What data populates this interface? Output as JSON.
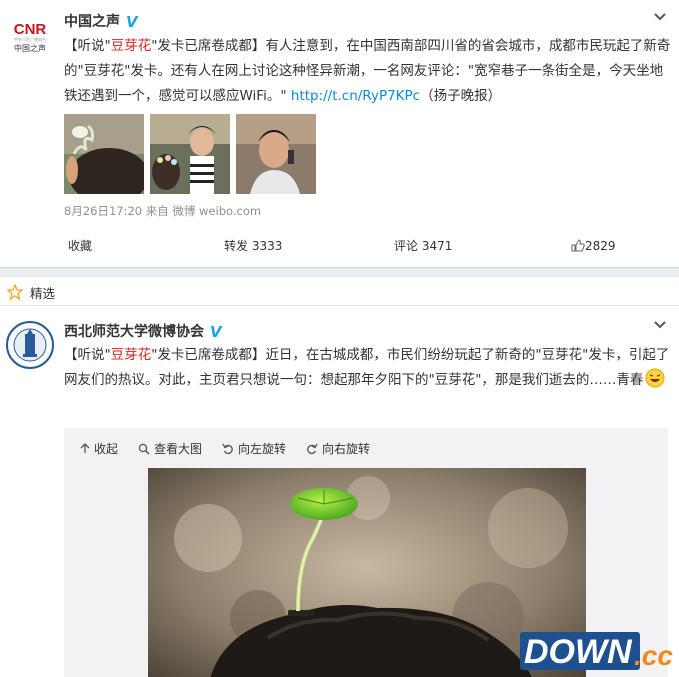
{
  "post1": {
    "avatar_text": "CNR",
    "avatar_sub": "中国之声",
    "username": "中国之声",
    "verified_badge": "V",
    "text_parts": {
      "bracket_open": "【听说\"",
      "highlight": "豆芽花",
      "bracket_rest": "\"发卡已席卷成都】",
      "body": "有人注意到，在中国西南部四川省的省会城市，成都市民玩起了新奇的\"豆芽花\"发卡。还有人在网上讨论这种怪异新潮，一名网友评论：\"宽窄巷子一条街全是，今天坐地铁还遇到一个，感觉可以感应WiFi。\"",
      "link": "http://t.cn/RyP7KPc",
      "source_tag": "（扬子晚报）"
    },
    "timestamp": "8月26日17:20",
    "source_prefix": "来自",
    "source": "微博 weibo.com",
    "actions": {
      "favorite": "收藏",
      "repost": "转发 3333",
      "comment": "评论 3471",
      "like": "2829"
    }
  },
  "featured": {
    "label": "精选"
  },
  "post2": {
    "username": "西北师范大学微博协会",
    "verified_badge": "V",
    "text_parts": {
      "bracket_open": "【听说\"",
      "highlight": "豆芽花",
      "bracket_rest": "\"发卡已席卷成都】",
      "body": "近日，在古城成都，市民们纷纷玩起了新奇的\"豆芽花\"发卡，引起了网友们的热议。对此，主页君只想说一句：想起那年夕阳下的\"豆芽花\"，那是我们逝去的……青春"
    },
    "media_tools": {
      "collapse": "收起",
      "view_large": "查看大图",
      "rotate_left": "向左旋转",
      "rotate_right": "向右旋转"
    }
  },
  "watermark": {
    "main": "DOWN",
    "suffix": ".cc"
  },
  "colors": {
    "link": "#0a8cd2",
    "highlight": "#e2211c",
    "verified": "#1aa3e7",
    "divider": "#e9ecef"
  }
}
